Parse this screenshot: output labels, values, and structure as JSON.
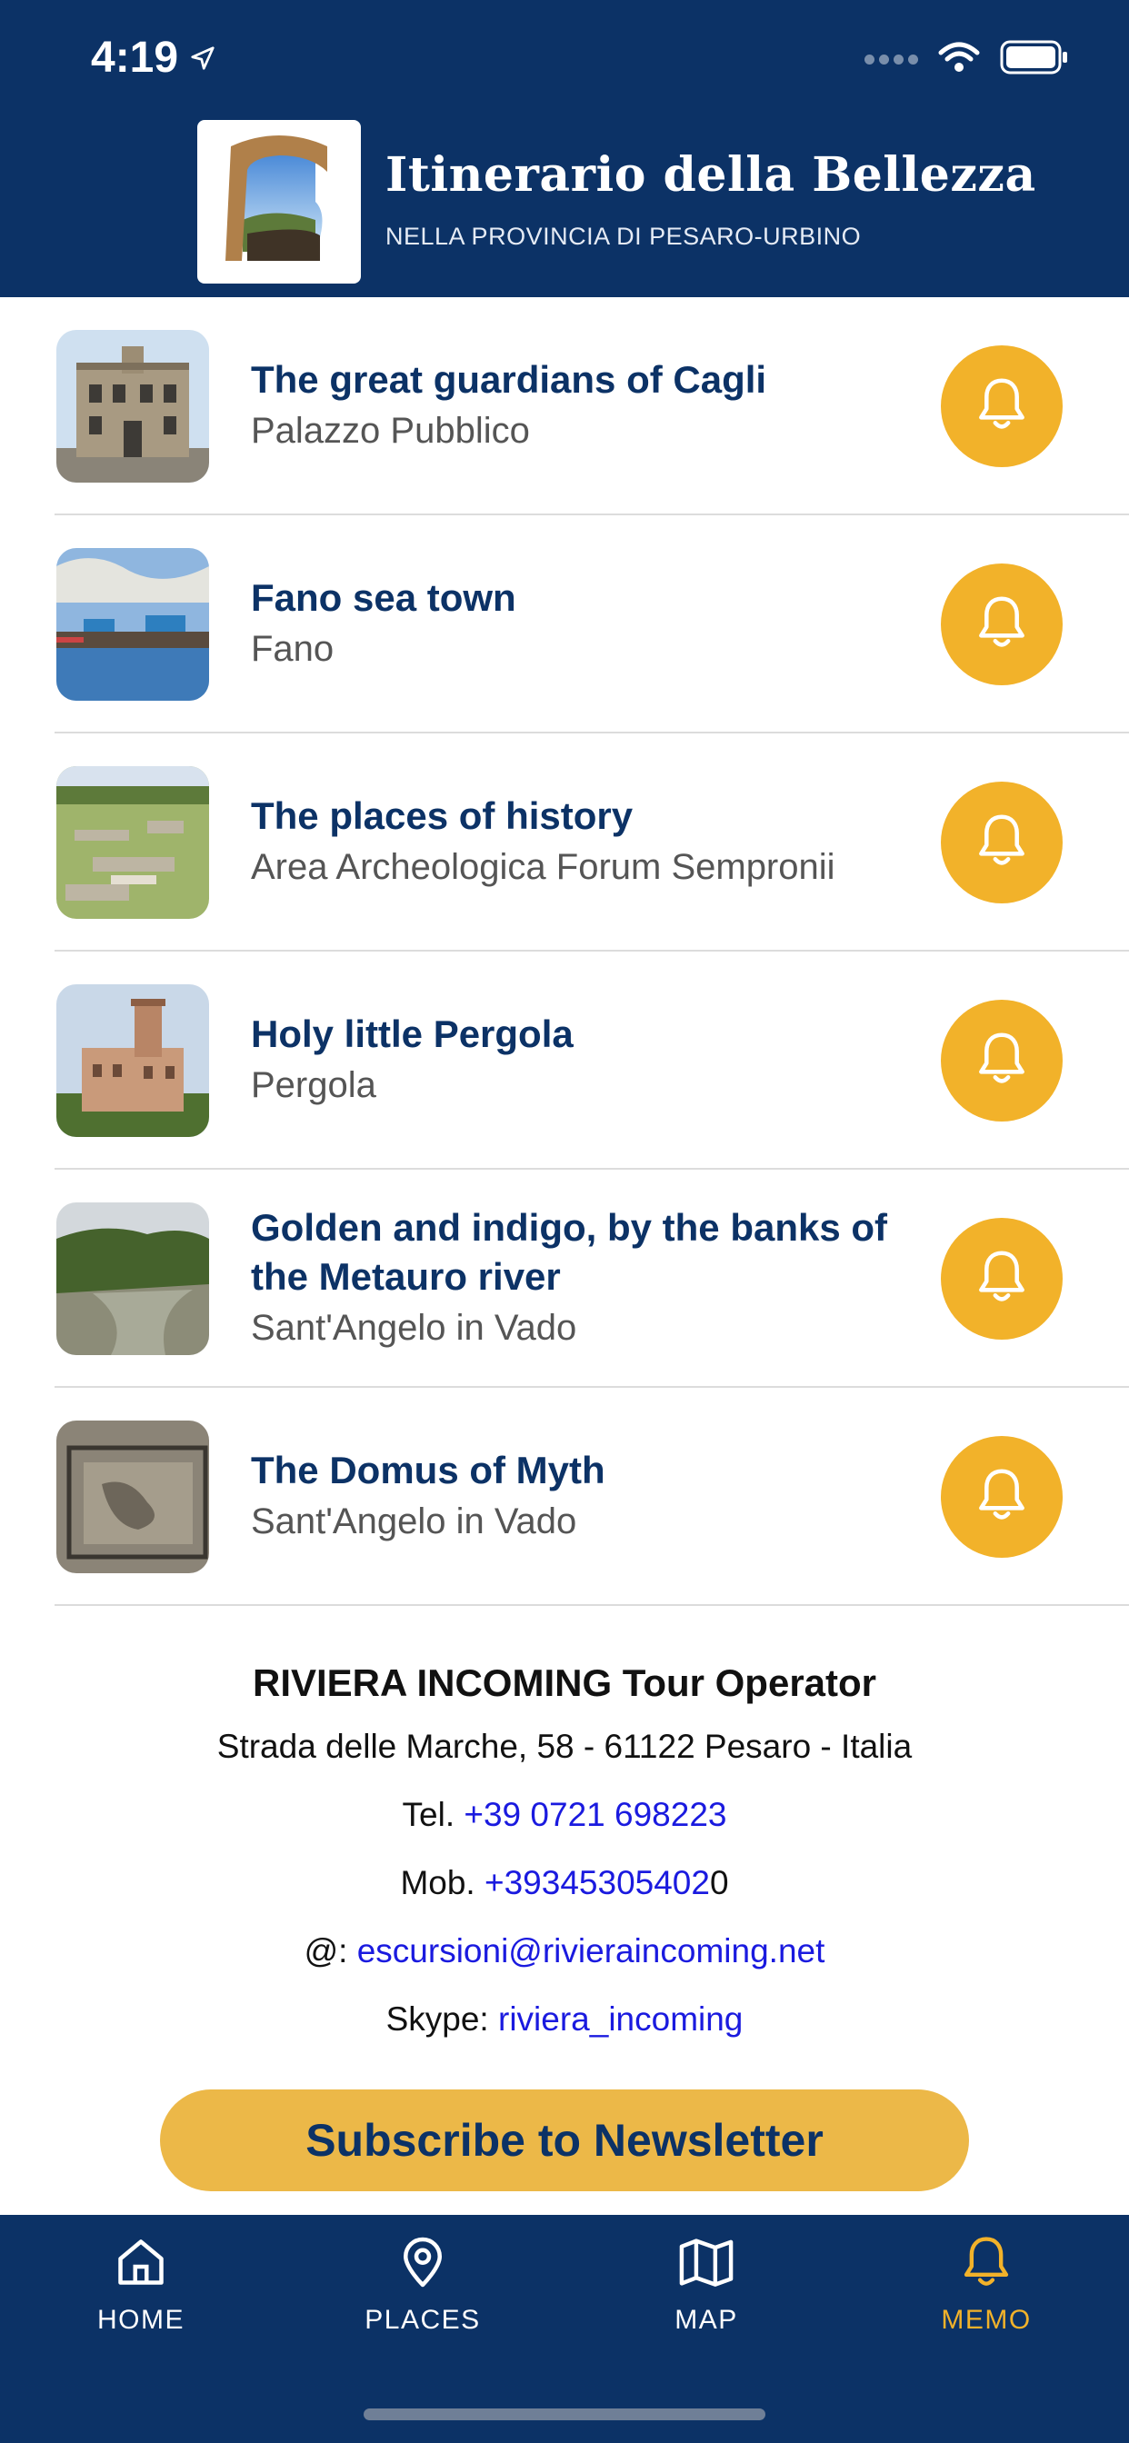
{
  "status_bar": {
    "time": "4:19"
  },
  "header": {
    "title": "Itinerario della Bellezza",
    "subtitle": "NELLA PROVINCIA DI PESARO-URBINO"
  },
  "items": [
    {
      "title": "The great guardians of Cagli",
      "subtitle": "Palazzo Pubblico",
      "thumbnail": "palazzo-image"
    },
    {
      "title": "Fano sea town",
      "subtitle": "Fano",
      "thumbnail": "pier-image"
    },
    {
      "title": "The places of history",
      "subtitle": "Area Archeologica Forum Sempronii",
      "thumbnail": "ruins-image"
    },
    {
      "title": "Holy little Pergola",
      "subtitle": "Pergola",
      "thumbnail": "tower-building-image"
    },
    {
      "title": "Golden and indigo, by the banks of the Metauro river",
      "subtitle": "Sant'Angelo in Vado",
      "thumbnail": "river-image"
    },
    {
      "title": "The Domus of Myth",
      "subtitle": "Sant'Angelo in Vado",
      "thumbnail": "mosaic-image"
    }
  ],
  "contact": {
    "company": "RIVIERA INCOMING Tour Operator",
    "address": "Strada delle Marche, 58 - 61122 Pesaro - Italia",
    "tel_label": "Tel.",
    "tel": "+39 0721 698223",
    "mob_label": "Mob.",
    "mob_link": "+39345305402",
    "mob_suffix": "0",
    "email_label": "@:",
    "email": "escursioni@rivieraincoming.net",
    "skype_label": "Skype:",
    "skype": "riviera_incoming"
  },
  "subscribe_label": "Subscribe to Newsletter",
  "tabs": [
    {
      "label": "HOME",
      "icon": "home-icon"
    },
    {
      "label": "PLACES",
      "icon": "location-pin-icon"
    },
    {
      "label": "MAP",
      "icon": "map-icon"
    },
    {
      "label": "MEMO",
      "icon": "bell-icon",
      "active": true
    }
  ],
  "colors": {
    "primary": "#0c3266",
    "accent": "#f2b22a",
    "link": "#1a1adf"
  }
}
